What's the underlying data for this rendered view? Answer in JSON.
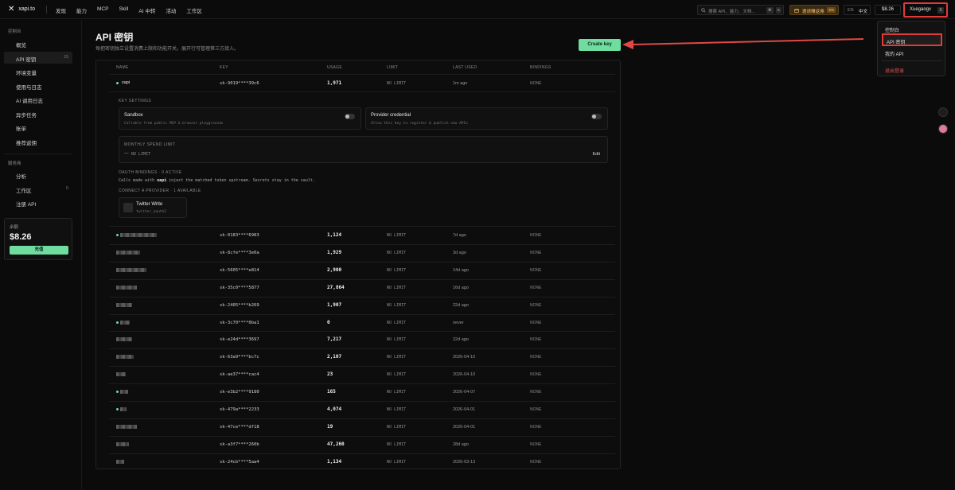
{
  "topbar": {
    "logo_mark": "✕",
    "logo_text": "xapi.to",
    "nav": [
      "发现",
      "能力",
      "MCP",
      "Skill",
      "AI 中转",
      "活动",
      "工作区"
    ],
    "search_placeholder": "搜索 API、能力、文档...",
    "search_kbd1": "⌘",
    "search_kbd2": "K",
    "invite_label": "邀请赚返佣",
    "invite_badge": "5%",
    "lang_en": "EN",
    "lang_zh": "中文",
    "balance": "$8.26",
    "user": "Xuegaogx",
    "user_x": "X"
  },
  "dropdown": {
    "items": [
      "控制台",
      "API 密钥",
      "我的 API",
      "退出登录"
    ]
  },
  "sidebar": {
    "head1": "控制台",
    "items": [
      {
        "label": "概览",
        "count": ""
      },
      {
        "label": "API 密钥",
        "count": "15"
      },
      {
        "label": "环境变量",
        "count": ""
      },
      {
        "label": "使用与日志",
        "count": ""
      },
      {
        "label": "AI 调用日志",
        "count": ""
      },
      {
        "label": "异步任务",
        "count": ""
      },
      {
        "label": "账单",
        "count": ""
      },
      {
        "label": "推荐返佣",
        "count": ""
      }
    ],
    "head2": "服务商",
    "items2": [
      {
        "label": "分析",
        "count": ""
      },
      {
        "label": "工作区",
        "count": "0"
      },
      {
        "label": "注册 API",
        "count": ""
      }
    ],
    "balance_label": "余额",
    "balance_value": "$8.26",
    "topup_label": "充值"
  },
  "main": {
    "title": "API 密钥",
    "subtitle": "每把密钥独立设置消费上限和功能开关。展开行可管理第三方接入。",
    "create_label": "Create key",
    "columns": [
      "NAME",
      "KEY",
      "USAGE",
      "LIMIT",
      "LAST USED",
      "BINDINGS"
    ],
    "first_row": {
      "name": "xapi",
      "key": "sk-9019****39c6",
      "usage": "1,971",
      "limit": "NO LIMIT",
      "last_used": "1m ago",
      "bindings": "NONE"
    },
    "expanded": {
      "key_settings": "KEY SETTINGS",
      "sandbox_title": "Sandbox",
      "sandbox_desc": "Callable from public MCP & browser playgrounds",
      "provider_title": "Provider credential",
      "provider_desc": "Allow this key to register & publish new APIs",
      "spend_head": "MONTHLY SPEND LIMIT",
      "spend_value": "NO LIMIT",
      "spend_dash": "—",
      "edit": "Edit",
      "oauth_head": "OAUTH BINDINGS · 0 ACTIVE",
      "oauth_desc_a": "Calls made with ",
      "oauth_desc_key": "xapi",
      "oauth_desc_b": " inject the matched token upstream. Secrets stay in the vault.",
      "connect_head": "CONNECT A PROVIDER · 1 AVAILABLE",
      "provider_card_title": "Twitter Write",
      "provider_card_sub": "twitter_oauth2"
    },
    "rows": [
      {
        "key": "sk-0183****6983",
        "usage": "1,124",
        "limit": "NO LIMIT",
        "last_used": "7d ago",
        "bindings": "NONE",
        "dot": true,
        "w": 46
      },
      {
        "key": "sk-8cfe****3e0a",
        "usage": "1,929",
        "limit": "NO LIMIT",
        "last_used": "3d ago",
        "bindings": "NONE",
        "dot": false,
        "w": 30
      },
      {
        "key": "sk-5605****e814",
        "usage": "2,900",
        "limit": "NO LIMIT",
        "last_used": "14d ago",
        "bindings": "NONE",
        "dot": false,
        "w": 38
      },
      {
        "key": "sk-35c0****5877",
        "usage": "27,864",
        "limit": "NO LIMIT",
        "last_used": "16d ago",
        "bindings": "NONE",
        "dot": false,
        "w": 26
      },
      {
        "key": "sk-2405****b269",
        "usage": "1,907",
        "limit": "NO LIMIT",
        "last_used": "22d ago",
        "bindings": "NONE",
        "dot": false,
        "w": 20
      },
      {
        "key": "sk-3c70****0ba1",
        "usage": "0",
        "limit": "NO LIMIT",
        "last_used": "never",
        "bindings": "NONE",
        "dot": true,
        "w": 12
      },
      {
        "key": "sk-e24d****3697",
        "usage": "7,217",
        "limit": "NO LIMIT",
        "last_used": "22d ago",
        "bindings": "NONE",
        "dot": false,
        "w": 20
      },
      {
        "key": "sk-63a9****bc7c",
        "usage": "2,107",
        "limit": "NO LIMIT",
        "last_used": "2026-04-10",
        "bindings": "NONE",
        "dot": false,
        "w": 22
      },
      {
        "key": "sk-ae37****cac4",
        "usage": "23",
        "limit": "NO LIMIT",
        "last_used": "2026-04-10",
        "bindings": "NONE",
        "dot": false,
        "w": 12
      },
      {
        "key": "sk-e3b2****9180",
        "usage": "165",
        "limit": "NO LIMIT",
        "last_used": "2026-04-07",
        "bindings": "NONE",
        "dot": true,
        "w": 10
      },
      {
        "key": "sk-479a****2233",
        "usage": "4,074",
        "limit": "NO LIMIT",
        "last_used": "2026-04-01",
        "bindings": "NONE",
        "dot": true,
        "w": 8
      },
      {
        "key": "sk-47ce****df18",
        "usage": "19",
        "limit": "NO LIMIT",
        "last_used": "2026-04-01",
        "bindings": "NONE",
        "dot": false,
        "w": 26
      },
      {
        "key": "sk-a3f7****260b",
        "usage": "47,260",
        "limit": "NO LIMIT",
        "last_used": "28d ago",
        "bindings": "NONE",
        "dot": false,
        "w": 16
      },
      {
        "key": "sk-24cb****5aa4",
        "usage": "1,134",
        "limit": "NO LIMIT",
        "last_used": "2026-03-13",
        "bindings": "NONE",
        "dot": false,
        "w": 10
      }
    ]
  },
  "colors": {
    "accent": "#6fdca0",
    "highlight": "#e03a3a"
  }
}
